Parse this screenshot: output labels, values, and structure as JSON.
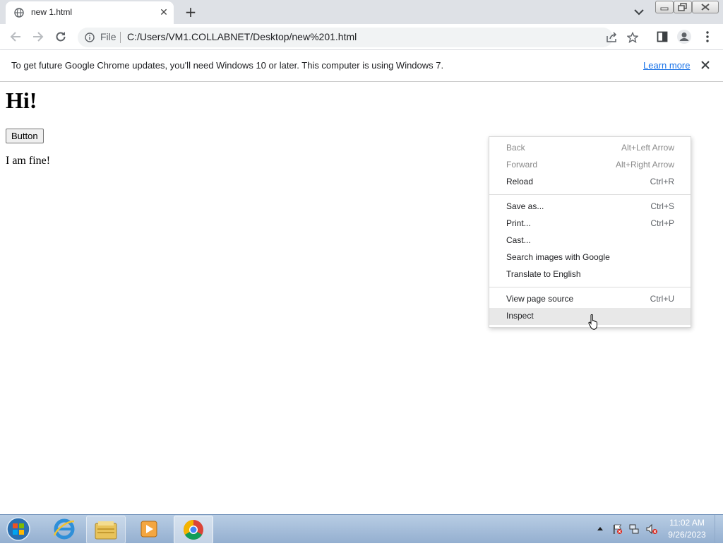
{
  "tab": {
    "title": "new 1.html",
    "close_glyph": "✕",
    "new_tab_glyph": "+"
  },
  "omnibox": {
    "scheme_label": "File",
    "url": "C:/Users/VM1.COLLABNET/Desktop/new%201.html"
  },
  "infobar": {
    "message": "To get future Google Chrome updates, you'll need Windows 10 or later. This computer is using Windows 7.",
    "link_label": "Learn more"
  },
  "page": {
    "heading": "Hi!",
    "button_label": "Button",
    "paragraph": "I am fine!"
  },
  "context_menu": {
    "groups": [
      [
        {
          "label": "Back",
          "shortcut": "Alt+Left Arrow",
          "disabled": true
        },
        {
          "label": "Forward",
          "shortcut": "Alt+Right Arrow",
          "disabled": true
        },
        {
          "label": "Reload",
          "shortcut": "Ctrl+R",
          "disabled": false
        }
      ],
      [
        {
          "label": "Save as...",
          "shortcut": "Ctrl+S",
          "disabled": false
        },
        {
          "label": "Print...",
          "shortcut": "Ctrl+P",
          "disabled": false
        },
        {
          "label": "Cast...",
          "shortcut": "",
          "disabled": false
        },
        {
          "label": "Search images with Google",
          "shortcut": "",
          "disabled": false
        },
        {
          "label": "Translate to English",
          "shortcut": "",
          "disabled": false
        }
      ],
      [
        {
          "label": "View page source",
          "shortcut": "Ctrl+U",
          "disabled": false
        },
        {
          "label": "Inspect",
          "shortcut": "",
          "disabled": false,
          "highlighted": true
        }
      ]
    ]
  },
  "taskbar": {
    "apps": [
      "internet-explorer-icon",
      "windows-explorer-icon",
      "media-player-icon",
      "chrome-icon"
    ],
    "clock": {
      "time": "11:02 AM",
      "date": "9/26/2023"
    }
  },
  "colors": {
    "tabstrip": "#dee1e6",
    "omnibox": "#f1f3f4",
    "link": "#1a73e8",
    "menu_highlight": "#e8e8e8",
    "taskbar": "#a5bdda"
  }
}
